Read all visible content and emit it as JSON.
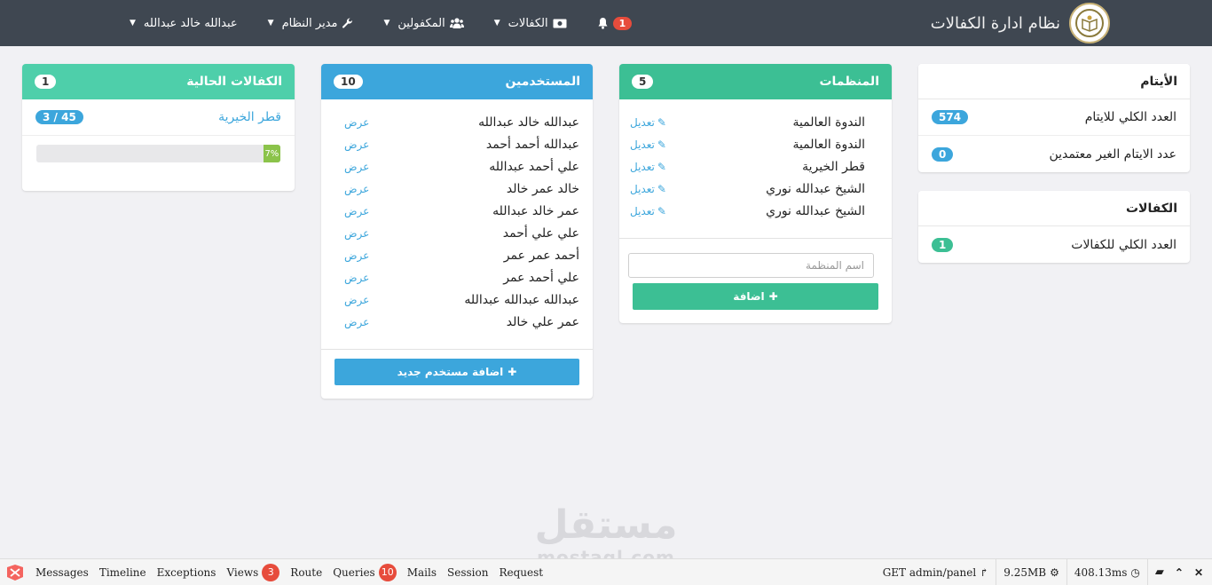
{
  "navbar": {
    "brand_title": "نظام ادارة الكفالات",
    "notifications_count": "1",
    "menu": {
      "sponsorships": "الكفالات",
      "sponsored": "المكفولين",
      "admin": "مدير النظام",
      "user": "عبدالله خالد عبدالله"
    }
  },
  "orphans_panel": {
    "title": "الأيتام",
    "rows": [
      {
        "label": "العدد الكلي للايتام",
        "value": "574"
      },
      {
        "label": "عدد الايتام الغير معتمدين",
        "value": "0"
      }
    ]
  },
  "sponsorships_panel": {
    "title": "الكفالات",
    "rows": [
      {
        "label": "العدد الكلي للكفالات",
        "value": "1"
      }
    ]
  },
  "orgs_panel": {
    "title": "المنظمات",
    "count": "5",
    "edit_label": "تعديل",
    "items": [
      "الندوة العالمية",
      "الندوة العالمية",
      "قطر الخيرية",
      "الشيخ عبدالله نوري",
      "الشيخ عبدالله نوري"
    ],
    "input_placeholder": "اسم المنظمة",
    "add_button": "اضافة"
  },
  "users_panel": {
    "title": "المستخدمين",
    "count": "10",
    "view_label": "عرض",
    "items": [
      "عبدالله خالد عبدالله",
      "عبدالله أحمد أحمد",
      "علي أحمد عبدالله",
      "خالد عمر خالد",
      "عمر خالد عبدالله",
      "علي علي أحمد",
      "أحمد عمر عمر",
      "علي أحمد عمر",
      "عبدالله عبدالله عبدالله",
      "عمر علي خالد"
    ],
    "add_button": "اضافة مستخدم جديد"
  },
  "current_panel": {
    "title": "الكفالات الحالية",
    "count": "1",
    "org_name": "قطر الخيرية",
    "ratio": "3 / 45",
    "progress_label": "7%",
    "progress_percent": 7
  },
  "watermark": {
    "arabic": "مستقل",
    "latin": "mostaql.com"
  },
  "debugbar": {
    "tabs": {
      "messages": "Messages",
      "timeline": "Timeline",
      "exceptions": "Exceptions",
      "views": "Views",
      "views_count": "3",
      "route": "Route",
      "queries": "Queries",
      "queries_count": "10",
      "mails": "Mails",
      "session": "Session",
      "request": "Request"
    },
    "route_info": "GET admin/panel",
    "memory": "9.25MB",
    "time": "408.13ms"
  },
  "colors": {
    "navbar": "#3f4751",
    "green": "#3cbf94",
    "blue": "#3ca6dc",
    "teal": "#4ecfaa",
    "danger": "#e74c3c",
    "progress": "#8bc34a"
  }
}
